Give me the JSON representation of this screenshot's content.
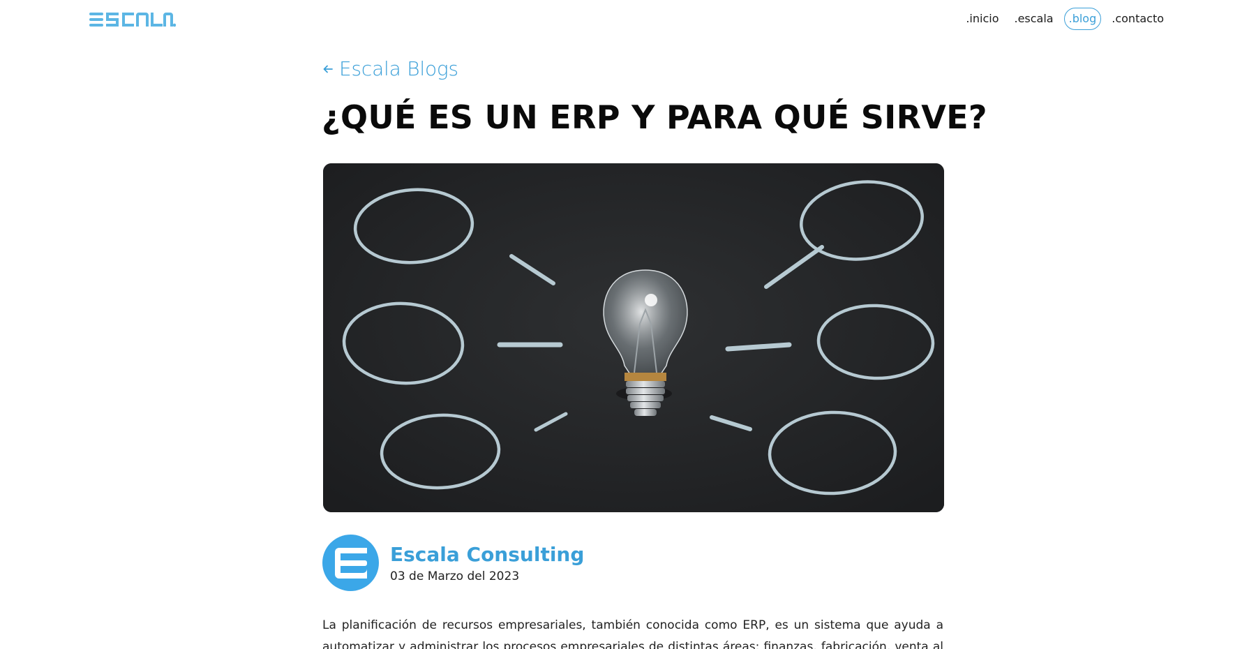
{
  "header": {
    "logo_text": "ESCALA.",
    "nav": [
      {
        "label": ".inicio",
        "active": false
      },
      {
        "label": ".escala",
        "active": false
      },
      {
        "label": ".blog",
        "active": true
      },
      {
        "label": ".contacto",
        "active": false
      }
    ]
  },
  "article": {
    "back_label": "Escala Blogs",
    "title": "¿QUÉ ES UN ERP Y PARA QUÉ SIRVE?",
    "hero_icon": "lightbulb-chalkboard-image",
    "author": {
      "name": "Escala Consulting",
      "date": "03 de Marzo del 2023"
    },
    "body": "La planificación de recursos empresariales, también conocida como ERP, es un sistema que ayuda a automatizar y administrar los procesos empresariales de distintas áreas: finanzas, fabricación, venta al por"
  },
  "colors": {
    "accent": "#3a9fd8",
    "avatar_bg": "#3ba7e8",
    "chalkboard": "#222426",
    "chalk": "#c8dde6"
  }
}
